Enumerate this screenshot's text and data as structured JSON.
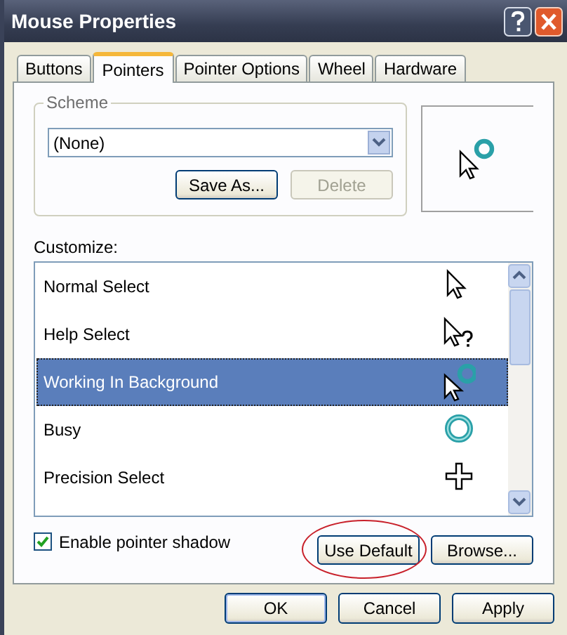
{
  "window": {
    "title": "Mouse Properties"
  },
  "tabs": [
    {
      "label": "Buttons",
      "selected": false
    },
    {
      "label": "Pointers",
      "selected": true
    },
    {
      "label": "Pointer Options",
      "selected": false
    },
    {
      "label": "Wheel",
      "selected": false
    },
    {
      "label": "Hardware",
      "selected": false
    }
  ],
  "scheme": {
    "label": "Scheme",
    "value": "(None)",
    "buttons": [
      {
        "label": "Save As...",
        "disabled": false
      },
      {
        "label": "Delete",
        "disabled": true
      }
    ]
  },
  "customize": {
    "label": "Customize:",
    "items": [
      {
        "label": "Normal Select",
        "kind": "arrow",
        "selected": false
      },
      {
        "label": "Help Select",
        "kind": "help",
        "selected": false
      },
      {
        "label": "Working In Background",
        "kind": "working",
        "selected": true
      },
      {
        "label": "Busy",
        "kind": "busy",
        "selected": false
      },
      {
        "label": "Precision Select",
        "kind": "cross",
        "selected": false
      }
    ]
  },
  "shadow": {
    "label": "Enable pointer shadow",
    "checked": true
  },
  "pointer_buttons": [
    {
      "label": "Use Default",
      "circled": true
    },
    {
      "label": "Browse...",
      "circled": false
    }
  ],
  "buttons": [
    {
      "label": "OK",
      "default": true
    },
    {
      "label": "Cancel",
      "default": false
    },
    {
      "label": "Apply",
      "default": false
    }
  ]
}
